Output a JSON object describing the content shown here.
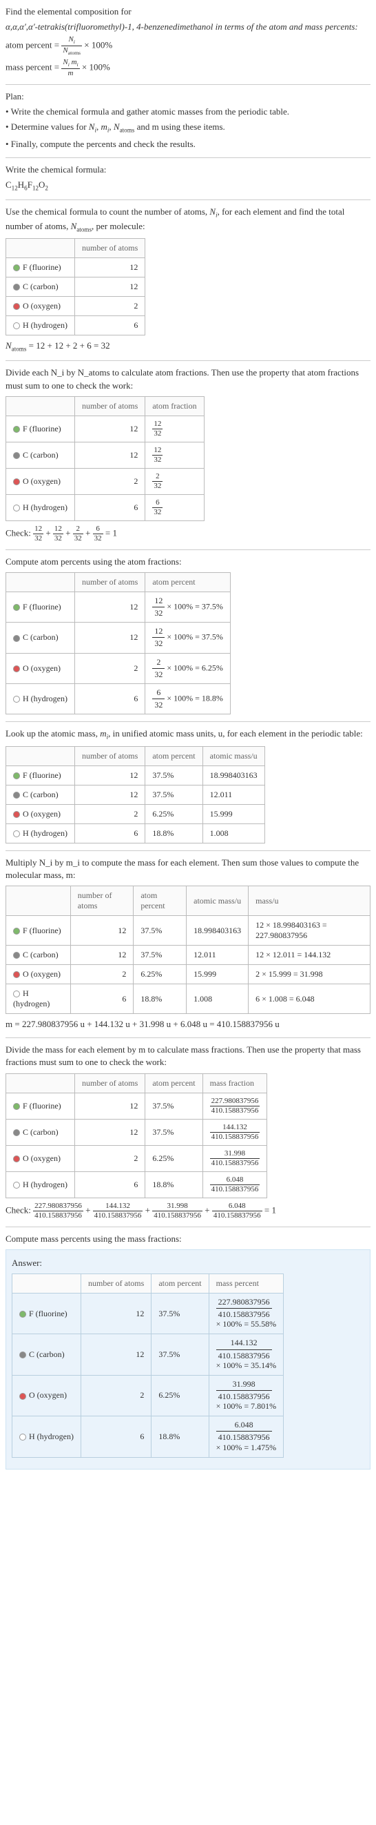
{
  "intro": {
    "line1": "Find the elemental composition for",
    "line2": "α,α,α',α'-tetrakis(trifluoromethyl)-1, 4-benzenedimethanol in terms of the atom and mass percents:",
    "atom_percent_lhs": "atom percent =",
    "atom_percent_eq_num": "N_i",
    "atom_percent_eq_den": "N_atoms",
    "times100": "× 100%",
    "mass_percent_lhs": "mass percent =",
    "mass_percent_eq_num": "N_i m_i",
    "mass_percent_eq_den": "m"
  },
  "plan": {
    "heading": "Plan:",
    "b1": "• Write the chemical formula and gather atomic masses from the periodic table.",
    "b2_a": "• Determine values for ",
    "b2_vars": "N_i, m_i, N_atoms",
    "b2_b": " and m using these items.",
    "b3": "• Finally, compute the percents and check the results."
  },
  "formula": {
    "text": "Write the chemical formula:",
    "value": "C₁₂H₆F₁₂O₂"
  },
  "count": {
    "text_a": "Use the chemical formula to count the number of atoms, ",
    "text_var1": "N_i",
    "text_b": ", for each element and find the total number of atoms, ",
    "text_var2": "N_atoms",
    "text_c": ", per molecule:",
    "col_atoms": "number of atoms",
    "sum_lhs": "N_atoms",
    "sum_eq": " = 12 + 12 + 2 + 6 = 32"
  },
  "elements": {
    "f": {
      "label": "F (fluorine)",
      "n": "12"
    },
    "c": {
      "label": "C (carbon)",
      "n": "12"
    },
    "o": {
      "label": "O (oxygen)",
      "n": "2"
    },
    "h": {
      "label": "H (hydrogen)",
      "n": "6"
    }
  },
  "atomfrac": {
    "text": "Divide each N_i by N_atoms to calculate atom fractions. Then use the property that atom fractions must sum to one to check the work:",
    "col_atoms": "number of atoms",
    "col_frac": "atom fraction",
    "f_num": "12",
    "f_den": "32",
    "c_num": "12",
    "c_den": "32",
    "o_num": "2",
    "o_den": "32",
    "h_num": "6",
    "h_den": "32",
    "check_label": "Check: ",
    "check_eq": " = 1"
  },
  "atompct": {
    "text": "Compute atom percents using the atom fractions:",
    "col_atoms": "number of atoms",
    "col_pct": "atom percent",
    "f_num": "12",
    "f_den": "32",
    "f_out": " × 100% = 37.5%",
    "c_num": "12",
    "c_den": "32",
    "c_out": " × 100% = 37.5%",
    "o_num": "2",
    "o_den": "32",
    "o_out": " × 100% = 6.25%",
    "h_num": "6",
    "h_den": "32",
    "h_out": " × 100% = 18.8%"
  },
  "mass_lookup": {
    "text_a": "Look up the atomic mass, ",
    "text_var": "m_i",
    "text_b": ", in unified atomic mass units, u, for each element in the periodic table:",
    "col_atoms": "number of atoms",
    "col_pct": "atom percent",
    "col_mass": "atomic mass/u",
    "f_pct": "37.5%",
    "f_mass": "18.998403163",
    "c_pct": "37.5%",
    "c_mass": "12.011",
    "o_pct": "6.25%",
    "o_mass": "15.999",
    "h_pct": "18.8%",
    "h_mass": "1.008"
  },
  "mass_calc": {
    "text": "Multiply N_i by m_i to compute the mass for each element. Then sum those values to compute the molecular mass, m:",
    "col_atoms": "number of atoms",
    "col_pct": "atom percent",
    "col_mass": "atomic mass/u",
    "col_prod": "mass/u",
    "f_prod": "12 × 18.998403163 = 227.980837956",
    "c_prod": "12 × 12.011 = 144.132",
    "o_prod": "2 × 15.999 = 31.998",
    "h_prod": "6 × 1.008 = 6.048",
    "sum": "m = 227.980837956 u + 144.132 u + 31.998 u + 6.048 u = 410.158837956 u"
  },
  "massfrac": {
    "text": "Divide the mass for each element by m to calculate mass fractions. Then use the property that mass fractions must sum to one to check the work:",
    "col_atoms": "number of atoms",
    "col_pct": "atom percent",
    "col_frac": "mass fraction",
    "den": "410.158837956",
    "f_num": "227.980837956",
    "c_num": "144.132",
    "o_num": "31.998",
    "h_num": "6.048",
    "check_label": "Check: ",
    "check_eq": " = 1"
  },
  "masspct": {
    "text": "Compute mass percents using the mass fractions:",
    "answer": "Answer:",
    "col_atoms": "number of atoms",
    "col_pct": "atom percent",
    "col_mpct": "mass percent",
    "den": "410.158837956",
    "f_num": "227.980837956",
    "f_out": "× 100% = 55.58%",
    "c_num": "144.132",
    "c_out": "× 100% = 35.14%",
    "o_num": "31.998",
    "o_out": "× 100% = 7.801%",
    "h_num": "6.048",
    "h_out": "× 100% = 1.475%"
  }
}
